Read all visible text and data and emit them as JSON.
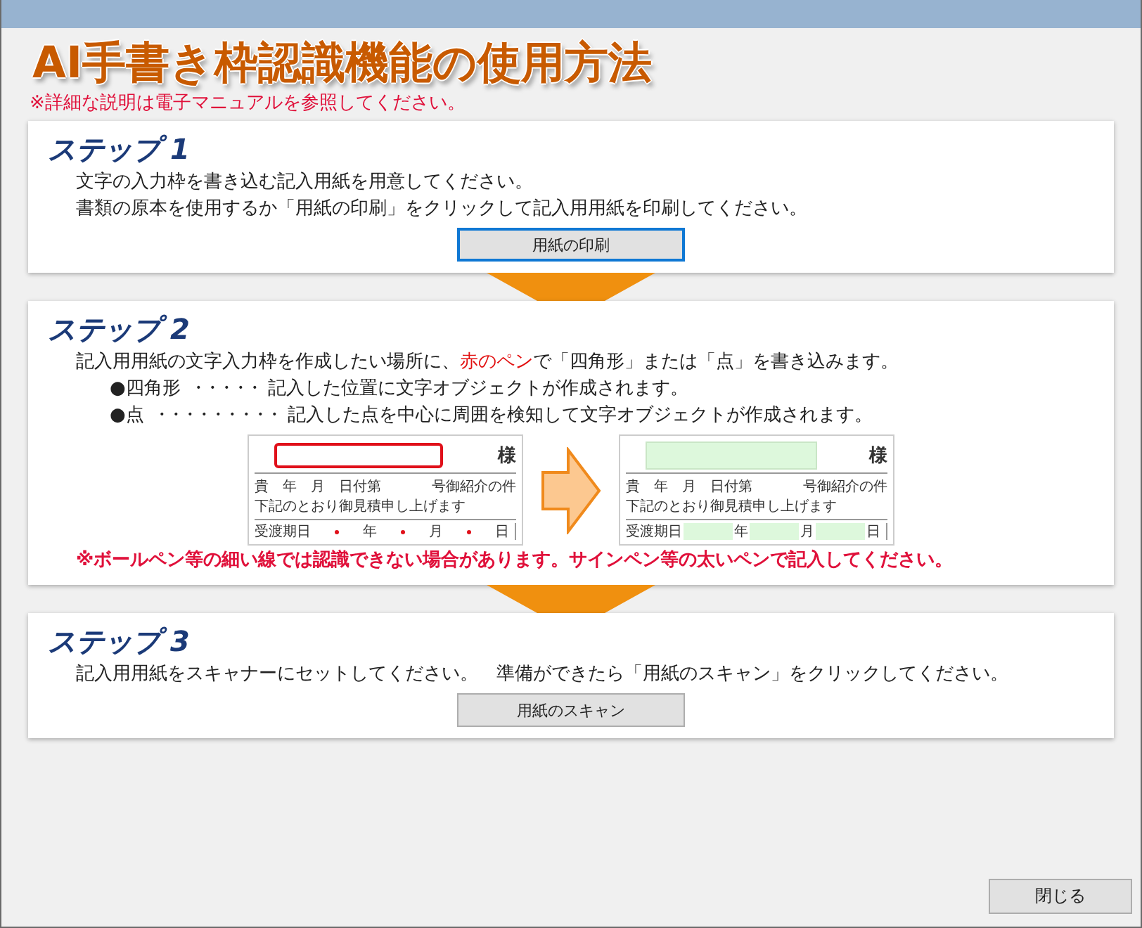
{
  "title": "AI手書き枠認識機能の使用方法",
  "subtitle": "※詳細な説明は電子マニュアルを参照してください。",
  "steps": [
    {
      "heading": "ステップ 1",
      "body": [
        {
          "kind": "line",
          "text": "文字の入力枠を書き込む記入用紙を用意してください。"
        },
        {
          "kind": "line",
          "text": "書類の原本を使用するか「用紙の印刷」をクリックして記入用用紙を印刷してください。"
        },
        {
          "kind": "button",
          "label": "用紙の印刷",
          "focused": true
        }
      ]
    },
    {
      "heading": "ステップ 2",
      "body": [
        {
          "kind": "segments",
          "parts": [
            {
              "text": "記入用用紙の文字入力枠を作成したい場所に、",
              "highlight": false
            },
            {
              "text": "赤のペン",
              "highlight": true
            },
            {
              "text": "で「四角形」または「点」を書き込みます。",
              "highlight": false
            }
          ]
        },
        {
          "kind": "bullet",
          "mark": "●",
          "label": "四角形",
          "leader": "・・・・・",
          "text": "記入した位置に文字オブジェクトが作成されます。"
        },
        {
          "kind": "bullet",
          "mark": "●",
          "label": "点",
          "leader": "・・・・・・・・・",
          "text": "記入した点を中心に周囲を検知して文字オブジェクトが作成されます。"
        },
        {
          "kind": "examples",
          "docs": [
            {
              "kind": "marked",
              "honorific": "様",
              "header": [
                "貴",
                "年",
                "月",
                "日付第",
                "号御紹介の件"
              ],
              "note": "下記のとおり御見積申し上げます",
              "row": [
                "受渡期日",
                "年",
                "月",
                "日"
              ]
            },
            {
              "kind": "filled",
              "honorific": "様",
              "header": [
                "貴",
                "年",
                "月",
                "日付第",
                "号御紹介の件"
              ],
              "note": "下記のとおり御見積申し上げます",
              "row": [
                "受渡期日",
                "年",
                "月",
                "日"
              ]
            }
          ]
        },
        {
          "kind": "warning",
          "text": "※ボールペン等の細い線では認識できない場合があります。サインペン等の太いペンで記入してください。"
        }
      ]
    },
    {
      "heading": "ステップ 3",
      "body": [
        {
          "kind": "line",
          "text": "記入用用紙をスキャナーにセットしてください。　準備ができたら「用紙のスキャン」をクリックしてください。"
        },
        {
          "kind": "button",
          "label": "用紙のスキャン",
          "focused": false
        }
      ]
    }
  ],
  "close_button": "閉じる"
}
